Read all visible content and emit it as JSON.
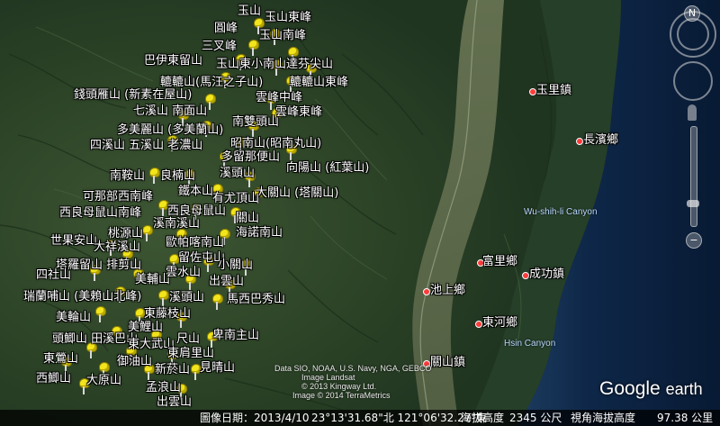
{
  "labels": {
    "yushan": "玉山",
    "yushan_east": "玉山東峰",
    "yuanfeng": "圓峰",
    "yushan_south": "玉山南峰",
    "sanchafeng": "三叉峰",
    "bayi_dongliu": "巴伊東留山",
    "yushan_dongxiaonan_dafen": "玉山東小南山達芬尖山",
    "lulu_mazi": "轆轆山(馬汪之子山)",
    "lulu_east": "轆轆山東峰",
    "qiantouyan": "錢頭雁山 (新素在屋山)",
    "yunfeng_north": "雲峰中峰",
    "qixi_nanmian": "七溪山 南面山",
    "yunfeng_east": "雲峰東峰",
    "nanshuangtou": "南雙頭山",
    "duomei_lan": "多美麗山 (多美蘭山)",
    "sixi_wuxi": "四溪山 五溪山 老濃山",
    "zhaonanqian": "昭南山(昭南丸山)",
    "duoliu_bian": "多留那便山",
    "nanchuan": "南鞍山",
    "liangnan": "良楠山",
    "xiyoushan": "溪頭山",
    "xiangyang": "向陽山 (紅葉山)",
    "tiewan": "鐵本山",
    "daguan": "大關山 (塔關山)",
    "kebu_ximan": "可那部西南峰",
    "youchen_ruju": "有尤頂山",
    "xiliang_mu": "西良母鼠山南峰",
    "xiliang_mu2": "西良母鼠山",
    "guanshan": "關山",
    "xiwuxi": "溪南溪山",
    "taoyuan": "桃源山",
    "hainuonan": "海諾南山",
    "shifu_anbi": "世果安山",
    "dajiyao": "大祥溪山",
    "ouxiang": "歐帕喀南山",
    "taluoliu": "塔羅留山 排剪山",
    "liuzhuang": "留佐屯山",
    "sileng": "四社山",
    "meiyu": "美輔山",
    "yunshui": "雲水山",
    "xiaoguan": "小關山",
    "ruilan_meibu": "瑞蘭哺山 (美賴山北峰)",
    "chuyu": "出雲山",
    "tongxi": "溪頭山",
    "maxiba": "馬西巴秀山",
    "meilun": "美輪山",
    "dongteng": "東藤枝山",
    "qiaoxi": "美鯉山",
    "tuxi_qiao": "頭鯽山 田溪巴山",
    "gunzi": "卑南主山",
    "xiongjian": "尺山",
    "dongdafen": "東大武山",
    "dongxiao": "東鶯山",
    "heyou": "御油山",
    "dongding": "東肩里山",
    "xiwu": "西鯽山",
    "dayuan": "大原山",
    "xinhe": "新菸山",
    "xinglong": "見晴山",
    "meng": "孟浪山",
    "chuyun": "出雲山",
    "yuli": "玉里鎮",
    "changbin": "長濱鄉",
    "fuli": "富里鄉",
    "chenggong": "成功鎮",
    "chishang": "池上鄉",
    "donghe": "東河鄉",
    "guanshan_town": "關山鎮",
    "canyon1": "Wu-shih-li Canyon",
    "canyon2": "Hsin Canyon"
  },
  "credits": {
    "line1": "Data SIO, NOAA, U.S. Navy, NGA, GEBCO",
    "line2": "Image Landsat",
    "line3": "© 2013 Kingway Ltd.",
    "line4": "Image © 2014 TerraMetrics"
  },
  "logo": {
    "brand": "Google",
    "product": "earth"
  },
  "status": {
    "image_date": "圖像日期：2013/4/10",
    "coords": "23°13'31.68\"北 121°06'32.27\"東",
    "elevation_label": "海拔高度",
    "elevation_value": "2345 公尺",
    "eye_alt_label": "視角海拔高度",
    "eye_alt_value": "97.38 公里"
  },
  "nav": {
    "north": "N",
    "zoom_in": "+",
    "zoom_out": "−"
  },
  "colors": {
    "pin": "#f2e51c",
    "town_dot": "#ff3b3b",
    "ocean": "#0a1d3a",
    "land": "#2d4427"
  }
}
